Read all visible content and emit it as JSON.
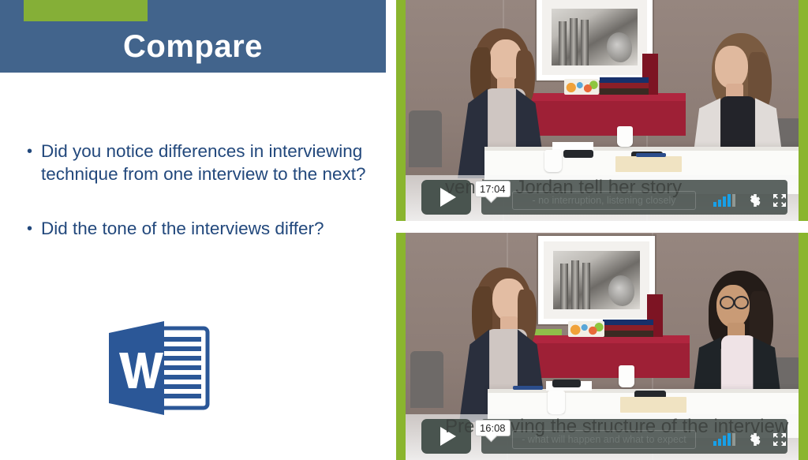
{
  "slide": {
    "title": "Compare",
    "accent_green": "#85af37",
    "header_blue": "#42648c",
    "text_blue": "#22487c"
  },
  "bullets": [
    {
      "marker": "•",
      "text": "Did you notice differences in interviewing technique from one interview to the next?"
    },
    {
      "marker": "•",
      "text": "Did the tone of the interviews differ?"
    }
  ],
  "word_icon": {
    "name": "microsoft-word-icon",
    "letter": "W",
    "brand_blue": "#2b5797"
  },
  "videos": [
    {
      "name": "video-player-top",
      "timestamp": "17:04",
      "overlay_title": "ven lets Jordan tell her story",
      "overlay_subtitle": "- no interruption, listening closely",
      "play_label": "▶",
      "controls": [
        "signal-bars-icon",
        "gear-icon",
        "fullscreen-icon"
      ],
      "edge_green": "#8ab52e"
    },
    {
      "name": "video-player-bottom",
      "timestamp": "16:08",
      "overlay_title_left": "Pre",
      "overlay_title": "ving the structure of the interview",
      "overlay_subtitle": "- what will happen and what to expect",
      "play_label": "▶",
      "controls": [
        "signal-bars-icon",
        "gear-icon",
        "fullscreen-icon"
      ],
      "edge_green": "#8ab52e"
    }
  ]
}
